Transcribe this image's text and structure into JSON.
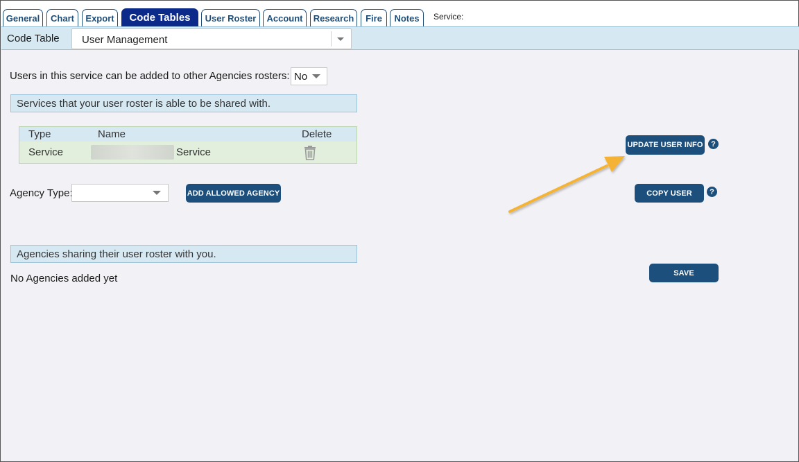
{
  "tabs": [
    {
      "label": "General",
      "active": false
    },
    {
      "label": "Chart",
      "active": false
    },
    {
      "label": "Export",
      "active": false
    },
    {
      "label": "Code Tables",
      "active": true
    },
    {
      "label": "User Roster",
      "active": false
    },
    {
      "label": "Account",
      "active": false
    },
    {
      "label": "Research",
      "active": false
    },
    {
      "label": "Fire",
      "active": false
    },
    {
      "label": "Notes",
      "active": false
    }
  ],
  "service_label": "Service:",
  "code_table": {
    "label": "Code Table",
    "selected": "User Management"
  },
  "share_setting": {
    "label": "Users in this service can be added to other Agencies rosters:",
    "value": "No"
  },
  "shared_services_section": {
    "title": "Services that your user roster is able to be shared with.",
    "columns": [
      "Type",
      "Name",
      "Delete"
    ],
    "rows": [
      {
        "type": "Service",
        "name": "Service"
      }
    ]
  },
  "agency_type": {
    "label": "Agency Type:",
    "value": ""
  },
  "buttons": {
    "add_allowed_agency": "ADD ALLOWED AGENCY",
    "update_user_info": "UPDATE USER INFO",
    "copy_user": "COPY USER",
    "save": "SAVE",
    "help": "?"
  },
  "agencies_sharing_section": {
    "title": "Agencies sharing their user roster with you.",
    "empty_text": "No Agencies added yet"
  },
  "colors": {
    "tab_active": "#0c2a8a",
    "button": "#1d4f7c",
    "section_bar": "#d6e8f2",
    "row_highlight": "#e2efdc",
    "annotation_arrow": "#f5b335"
  },
  "icons": {
    "delete": "trash-icon",
    "help": "question-circle-icon",
    "annotation": "arrow-annotation"
  }
}
